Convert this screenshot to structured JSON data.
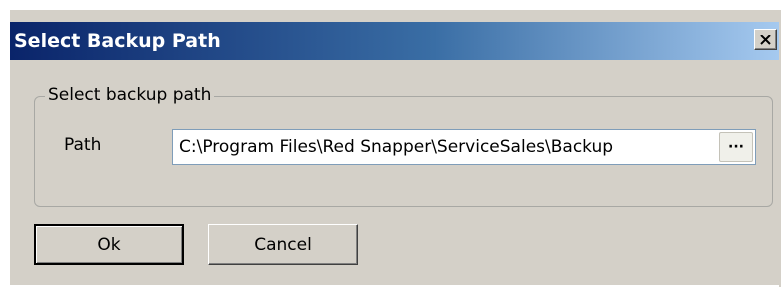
{
  "window": {
    "title": "Select Backup Path",
    "close_icon": "close-x-icon"
  },
  "group": {
    "legend": "Select backup path",
    "path_label": "Path",
    "path_value": "C:\\Program Files\\Red Snapper\\ServiceSales\\Backup",
    "browse_label": "···"
  },
  "buttons": {
    "ok_label": "Ok",
    "cancel_label": "Cancel"
  },
  "colors": {
    "titlebar_start": "#0a246a",
    "titlebar_end": "#a6caf0",
    "dialog_face": "#d4d0c8",
    "field_border": "#7f9db9"
  }
}
